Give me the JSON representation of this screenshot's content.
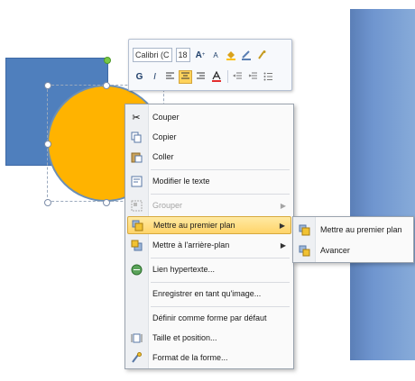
{
  "colors": {
    "rectangle": "#4f7fbd",
    "circle": "#ffb300",
    "highlight": "#ffd46a",
    "panel": "#6f95cf"
  },
  "mini_toolbar": {
    "font_name": "Calibri (C",
    "font_size": "18",
    "grow_font": "A",
    "shrink_font": "A",
    "bold": "G",
    "italic": "I"
  },
  "context_menu": {
    "items": [
      {
        "label": "Couper",
        "icon": "scissors-icon"
      },
      {
        "label": "Copier",
        "icon": "copy-icon"
      },
      {
        "label": "Coller",
        "icon": "paste-icon"
      },
      {
        "label": "Modifier le texte",
        "icon": "edit-text-icon"
      },
      {
        "label": "Grouper",
        "icon": "group-icon",
        "disabled": true
      },
      {
        "label": "Mettre au premier plan",
        "icon": "bring-front-icon",
        "highlighted": true
      },
      {
        "label": "Mettre à l'arrière-plan",
        "icon": "send-back-icon"
      },
      {
        "label": "Lien hypertexte...",
        "icon": "hyperlink-icon"
      },
      {
        "label": "Enregistrer en tant qu'image...",
        "icon": ""
      },
      {
        "label": "Définir comme forme par défaut",
        "icon": ""
      },
      {
        "label": "Taille et position...",
        "icon": "size-position-icon"
      },
      {
        "label": "Format de la forme...",
        "icon": "format-shape-icon"
      }
    ]
  },
  "submenu": {
    "items": [
      {
        "label": "Mettre au premier plan",
        "icon": "bring-to-front-icon"
      },
      {
        "label": "Avancer",
        "icon": "bring-forward-icon"
      }
    ]
  }
}
